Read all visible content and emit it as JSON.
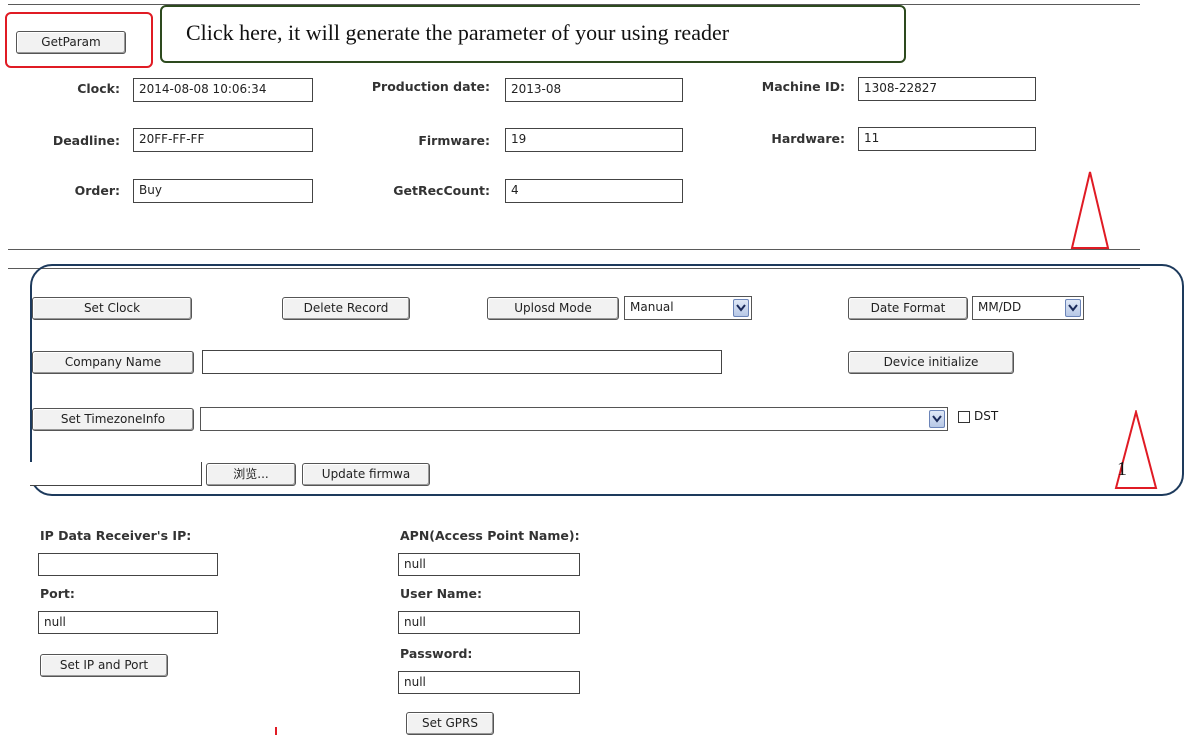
{
  "top_bar": {
    "getparam_label": "GetParam",
    "callout_text": "Click here, it will generate the parameter of your using reader"
  },
  "params": {
    "clock_label": "Clock:",
    "clock_value": "2014-08-08 10:06:34",
    "production_date_label": "Production date:",
    "production_date_value": "2013-08",
    "machine_id_label": "Machine ID:",
    "machine_id_value": "1308-22827",
    "deadline_label": "Deadline:",
    "deadline_value": "20FF-FF-FF",
    "firmware_label": "Firmware:",
    "firmware_value": "19",
    "hardware_label": "Hardware:",
    "hardware_value": "11",
    "order_label": "Order:",
    "order_value": "Buy",
    "getreccount_label": "GetRecCount:",
    "getreccount_value": "4"
  },
  "actions": {
    "set_clock": "Set Clock",
    "delete_record": "Delete Record",
    "upload_mode": "Uplosd Mode",
    "upload_mode_selected": "Manual",
    "date_format": "Date Format",
    "date_format_selected": "MM/DD",
    "company_name": "Company Name",
    "company_name_value": "",
    "device_initialize": "Device initialize",
    "set_timezone": "Set TimezoneInfo",
    "timezone_selected": "",
    "dst_label": "DST",
    "file_path_value": "",
    "browse_label": "浏览...",
    "update_firmware": "Update firmwa"
  },
  "annotation": {
    "marker_number": "1"
  },
  "network": {
    "ip_label": "IP Data Receiver's IP:",
    "ip_value": "",
    "port_label": "Port:",
    "port_value": "null",
    "set_ip_port": "Set IP and Port",
    "apn_label": "APN(Access Point Name):",
    "apn_value": "null",
    "user_name_label": "User Name:",
    "user_name_value": "null",
    "password_label": "Password:",
    "password_value": "null",
    "set_gprs": "Set GPRS"
  },
  "colors": {
    "red_annotation": "#e01b24",
    "green_annotation": "#2d4a1e",
    "blue_annotation": "#1d3a5c",
    "select_arrow": "#6b84b8"
  }
}
